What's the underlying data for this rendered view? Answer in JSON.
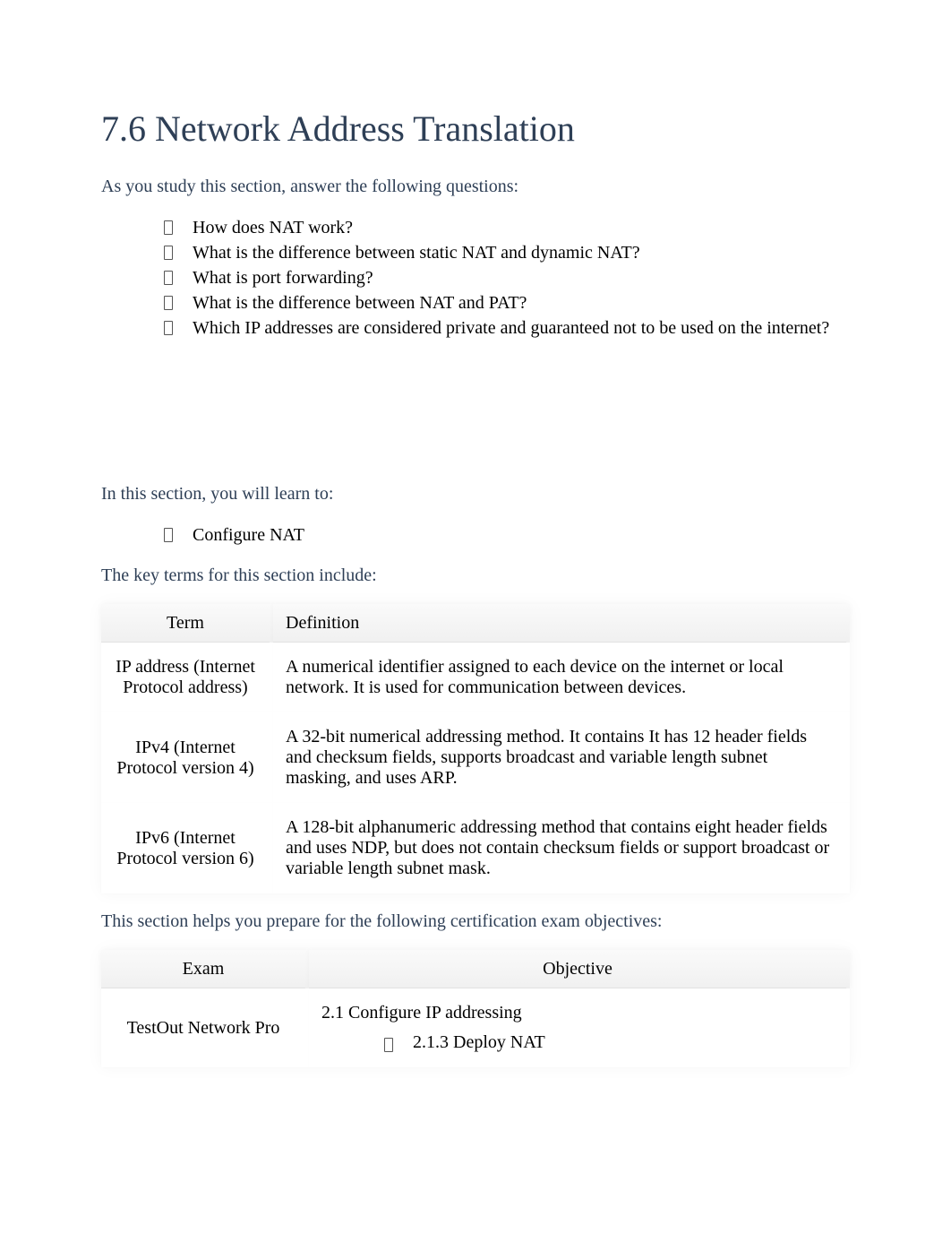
{
  "title": "7.6 Network Address Translation",
  "intro1": "As you study this section, answer the following questions:",
  "questions": [
    "How does NAT work?",
    "What is the difference between static NAT and dynamic NAT?",
    "What is port forwarding?",
    "What is the difference between NAT and PAT?",
    "Which IP addresses are considered private and guaranteed not to be used on the internet?"
  ],
  "intro2": "In this section, you will learn to:",
  "learn": [
    "Configure NAT"
  ],
  "intro3": "The key terms for this section include:",
  "terms_table": {
    "headers": {
      "term": "Term",
      "definition": "Definition"
    },
    "rows": [
      {
        "term": "IP address (Internet Protocol address)",
        "definition": "A numerical identifier assigned to each device on the internet or local network. It is used for communication between devices."
      },
      {
        "term": "IPv4 (Internet Protocol version 4)",
        "definition": "A 32-bit numerical addressing method. It contains It has 12 header fields and checksum fields, supports broadcast and variable length subnet masking, and uses ARP."
      },
      {
        "term": "IPv6 (Internet Protocol version 6)",
        "definition": "A 128-bit alphanumeric addressing method that contains eight header fields and uses NDP, but does not contain checksum fields or support broadcast or variable length subnet mask."
      }
    ]
  },
  "intro4": "This section helps you prepare for the following certification exam objectives:",
  "exam_table": {
    "headers": {
      "exam": "Exam",
      "objective": "Objective"
    },
    "rows": [
      {
        "exam": "TestOut Network Pro",
        "objective_head": "2.1 Configure IP addressing",
        "objective_items": [
          "2.1.3 Deploy NAT"
        ]
      }
    ]
  }
}
